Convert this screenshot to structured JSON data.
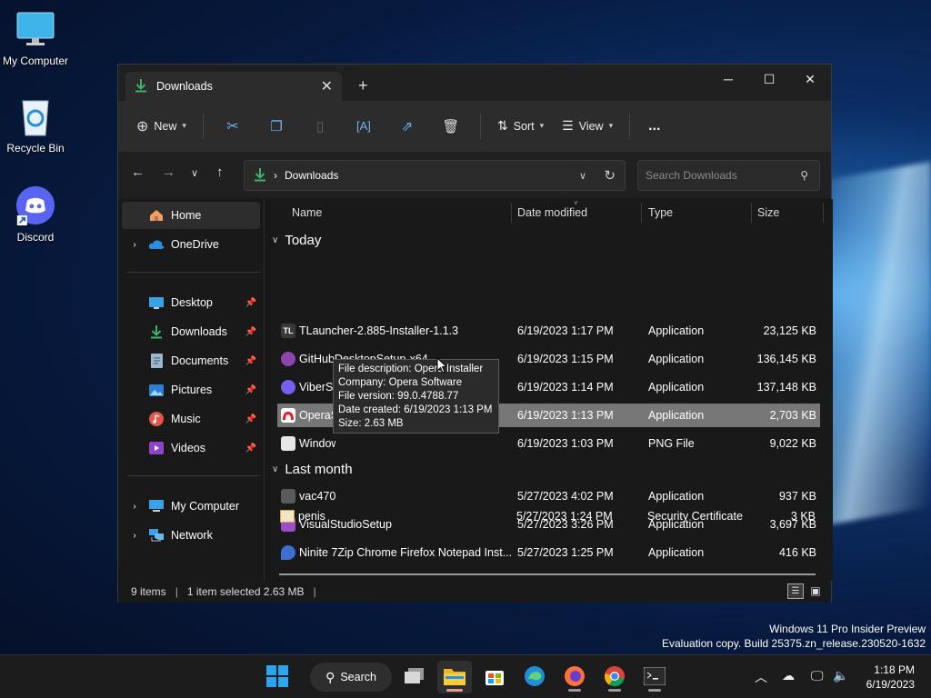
{
  "desktop": {
    "icons": [
      {
        "label": "My Computer"
      },
      {
        "label": "Recycle Bin"
      },
      {
        "label": "Discord"
      }
    ]
  },
  "window": {
    "tab_title": "Downloads",
    "toolbar": {
      "new_label": "New",
      "sort_label": "Sort",
      "view_label": "View",
      "more_label": "..."
    },
    "address": {
      "segment": "Downloads",
      "separator": "›"
    },
    "search": {
      "placeholder": "Search Downloads"
    }
  },
  "nav": {
    "home": "Home",
    "onedrive": "OneDrive",
    "pinned": [
      "Desktop",
      "Downloads",
      "Documents",
      "Pictures",
      "Music",
      "Videos"
    ],
    "my_computer": "My Computer",
    "network": "Network"
  },
  "columns": {
    "name": "Name",
    "date": "Date modified",
    "type": "Type",
    "size": "Size"
  },
  "groups": {
    "today": "Today",
    "last_month": "Last month"
  },
  "files": [
    {
      "name": "TLauncher-2.885-Installer-1.1.3",
      "date": "6/19/2023 1:17 PM",
      "type": "Application",
      "size": "23,125 KB",
      "icon_color": "#3a3a3a"
    },
    {
      "name": "GitHubDesktopSetup-x64",
      "date": "6/19/2023 1:15 PM",
      "type": "Application",
      "size": "136,145 KB",
      "icon_color": "#8e44ad"
    },
    {
      "name": "ViberSetup",
      "date": "6/19/2023 1:14 PM",
      "type": "Application",
      "size": "137,148 KB",
      "icon_color": "#7360f2"
    },
    {
      "name": "OperaSetup",
      "date": "6/19/2023 1:13 PM",
      "type": "Application",
      "size": "2,703 KB",
      "icon_color": "#e0202a"
    },
    {
      "name": "Windows",
      "date": "6/19/2023 1:03 PM",
      "type": "PNG File",
      "size": "9,022 KB",
      "icon_color": "#d9d9d9"
    },
    {
      "name": "vac470",
      "date": "5/27/2023 4:02 PM",
      "type": "Application",
      "size": "937 KB",
      "icon_color": "#4a4a4a"
    },
    {
      "name": "VisualStudioSetup",
      "date": "5/27/2023 3:26 PM",
      "type": "Application",
      "size": "3,697 KB",
      "icon_color": "#9b4dca"
    },
    {
      "name": "Ninite 7Zip Chrome Firefox Notepad Inst...",
      "date": "5/27/2023 1:25 PM",
      "type": "Application",
      "size": "416 KB",
      "icon_color": "#3d6fd1"
    },
    {
      "name": "penis",
      "date": "5/27/2023 1:24 PM",
      "type": "Security Certificate",
      "size": "3 KB",
      "icon_color": "#c9a64a"
    }
  ],
  "tooltip": {
    "line1": "File description: Opera Installer",
    "line2": "Company: Opera Software",
    "line3": "File version: 99.0.4788.77",
    "line4": "Date created: 6/19/2023 1:13 PM",
    "line5": "Size: 2.63 MB"
  },
  "status": {
    "items": "9 items",
    "selected": "1 item selected  2.63 MB"
  },
  "watermark": {
    "line1": "Windows 11 Pro Insider Preview",
    "line2": "Evaluation copy. Build 25375.zn_release.230520-1632"
  },
  "taskbar": {
    "search_label": "Search",
    "time": "1:18 PM",
    "date": "6/19/2023"
  },
  "colors": {
    "accent": "#6cb4ee",
    "selected_row": "#777777",
    "download_green": "#3fb36e"
  }
}
